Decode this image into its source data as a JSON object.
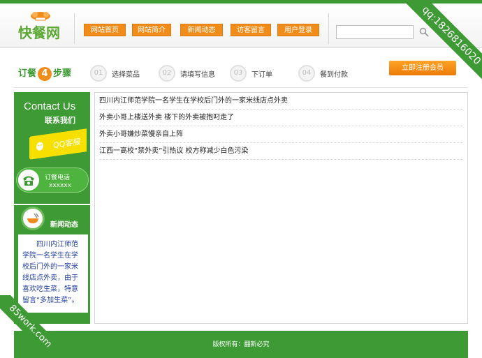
{
  "header": {
    "logo_text": "快餐网",
    "nav": [
      "网站首页",
      "网站简介",
      "新闻动态",
      "访客留言",
      "用户登录"
    ],
    "search": {
      "value": "",
      "placeholder": ""
    }
  },
  "steps": {
    "title_prefix": "订餐",
    "title_num": "4",
    "title_suffix": "步骤",
    "items": [
      {
        "num": "01",
        "label": "选择菜品"
      },
      {
        "num": "02",
        "label": "请填写信息"
      },
      {
        "num": "03",
        "label": "下订单"
      },
      {
        "num": "04",
        "label": "餐到付款"
      }
    ],
    "register_label": "立即注册会员"
  },
  "sidebar": {
    "contact_en": "Contact Us",
    "contact_cn": "联系我们",
    "qq_label": "QQ客服",
    "phone_label": "订餐电话",
    "phone_number": "xxxxxx",
    "news_title": "新闻动态",
    "news_body": "四川内江师范学院一名学生在学校后门外的一家米线店点外卖，由于喜欢吃生菜，特意留言“多加生菜”。"
  },
  "articles": [
    "四川内江师范学院一名学生在学校后门外的一家米线店点外卖",
    "外卖小哥上楼送外卖 楼下的外卖被抱叼走了",
    "外卖小哥嫌炒菜慢亲自上阵",
    "江西一高校“禁外卖”引热议 校方称减少白色污染"
  ],
  "footer": {
    "text": "版权所有：翻新必究"
  },
  "watermarks": {
    "top_right": "qq:1826816020",
    "bottom_left": "85work.com"
  },
  "colors": {
    "brand_green": "#3d9a34",
    "accent_orange": "#f08c1a",
    "qq_yellow": "#f7e000"
  }
}
